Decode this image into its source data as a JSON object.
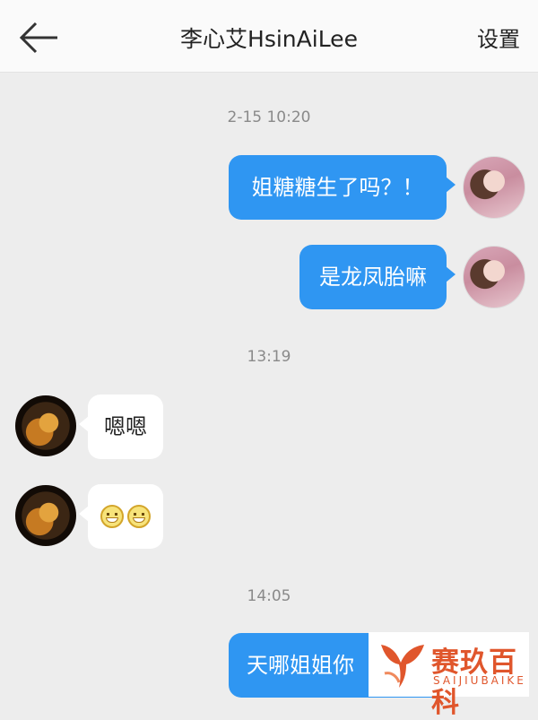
{
  "header": {
    "title": "李心艾HsinAiLee",
    "settings_label": "设置",
    "back_icon": "arrow-left-icon"
  },
  "timestamps": [
    "2-15 10:20",
    "13:19",
    "14:05"
  ],
  "messages": [
    {
      "side": "out",
      "text": "姐糖糖生了吗？！"
    },
    {
      "side": "out",
      "text": "是龙凤胎嘛"
    },
    {
      "side": "in",
      "text": "嗯嗯"
    },
    {
      "side": "in",
      "text": "",
      "icons": [
        "grin-emoji-icon",
        "grin-emoji-icon"
      ]
    },
    {
      "side": "out",
      "text": "天哪姐姐你"
    }
  ],
  "watermark": {
    "text_cn": "赛玖百科",
    "text_en": "SAIJIUBAIKE",
    "icon": "whale-tail-icon"
  },
  "colors": {
    "outgoing_bubble": "#2f96f2",
    "incoming_bubble": "#ffffff",
    "background": "#ededed",
    "watermark": "#e0562c"
  }
}
